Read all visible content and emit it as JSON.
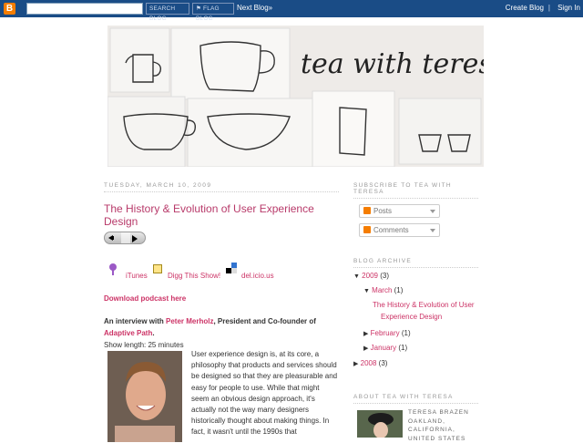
{
  "navbar": {
    "logo": "B",
    "search_button": "SEARCH BLOG",
    "flag_button": "⚑ FLAG BLOG",
    "next_blog": "Next Blog»",
    "create_blog": "Create Blog",
    "separator": "|",
    "sign_in": "Sign In"
  },
  "header": {
    "title": "tea with teresa"
  },
  "post": {
    "date": "TUESDAY, MARCH 10, 2009",
    "title": "The History & Evolution of User Experience Design",
    "links": {
      "itunes": "iTunes",
      "digg": "Digg This Show!",
      "delicious": "del.icio.us"
    },
    "download": "Download podcast here",
    "interview_prefix": "An interview with ",
    "interview_person": "Peter Merholz",
    "interview_middle": ", President and Co-founder of ",
    "interview_company": "Adaptive Path",
    "interview_suffix": ".",
    "show_length": "Show length: 25 minutes",
    "body": "User experience design is, at its core, a philosophy that products and services should be designed so that they are pleasurable and easy for people to use. While that might seem an obvious design approach, it's actually not the way many designers historically thought about making things. In fact, it wasn't until the 1990s that"
  },
  "sidebar": {
    "subscribe_heading": "SUBSCRIBE TO TEA WITH TERESA",
    "posts_label": "Posts",
    "comments_label": "Comments",
    "archive_heading": "BLOG ARCHIVE",
    "archive": {
      "y2009": "2009",
      "y2009_count": "(3)",
      "march": "March",
      "march_count": "(1)",
      "march_post_line1": "The History & Evolution of User",
      "march_post_line2": "Experience Design",
      "february": "February",
      "february_count": "(1)",
      "january": "January",
      "january_count": "(1)",
      "y2008": "2008",
      "y2008_count": "(3)"
    },
    "about_heading": "ABOUT TEA WITH TERESA",
    "about_name": "TERESA BRAZEN",
    "about_location": "OAKLAND, CALIFORNIA, UNITED STATES"
  },
  "colors": {
    "navbar": "#1a4c86",
    "link": "#cc3366",
    "accent": "#f57d00"
  }
}
